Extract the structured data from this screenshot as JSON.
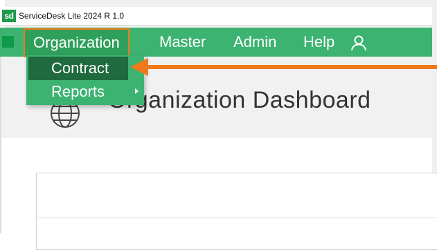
{
  "window": {
    "app_icon_text": "sd",
    "title": "ServiceDesk Lite 2024 R 1.0"
  },
  "menubar": {
    "items": [
      {
        "label": "Organization"
      },
      {
        "label": "Master"
      },
      {
        "label": "Admin"
      },
      {
        "label": "Help"
      }
    ],
    "user_icon": "user-icon"
  },
  "dropdown": {
    "items": [
      {
        "label": "Contract",
        "highlighted": true
      },
      {
        "label": "Reports",
        "has_submenu": true
      }
    ]
  },
  "page": {
    "title": "Organization Dashboard",
    "icon": "globe-icon"
  },
  "colors": {
    "menubar": "#3cb371",
    "menu_highlight": "#1f6b3e",
    "annotation": "#f07a1a",
    "app_icon": "#1e9a4a"
  }
}
